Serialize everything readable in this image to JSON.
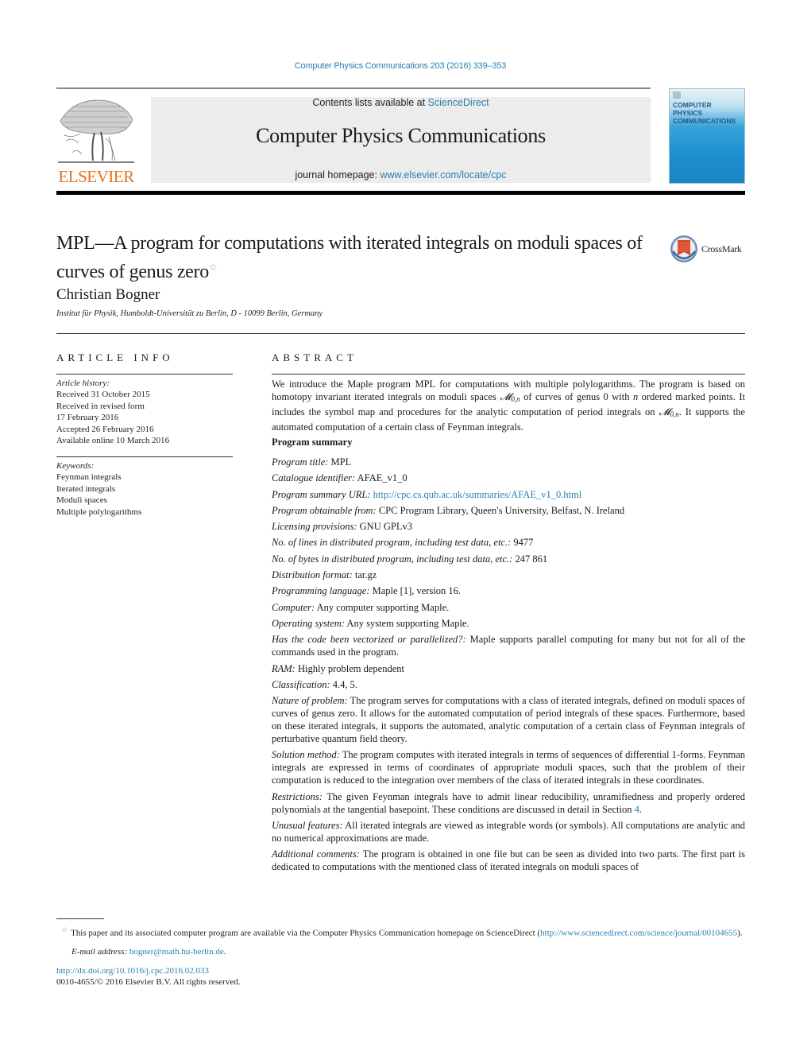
{
  "header": {
    "journal_reference": "Computer Physics Communications 203 (2016) 339–353",
    "contents_prefix": "Contents lists available at ",
    "contents_link": "ScienceDirect",
    "journal_title": "Computer Physics Communications",
    "homepage_prefix": "journal homepage: ",
    "homepage_link": "www.elsevier.com/locate/cpc",
    "publisher_logo_text": "ELSEVIER",
    "cover_title_line1": "COMPUTER PHYSICS",
    "cover_title_line2": "COMMUNICATIONS",
    "crossmark_label": "CrossMark"
  },
  "article": {
    "title": "MPL—A program for computations with iterated integrals on moduli spaces of curves of genus zero",
    "title_footnote_mark": "☆",
    "author": "Christian Bogner",
    "affiliation": "Institut für Physik, Humboldt-Universität zu Berlin, D - 10099 Berlin, Germany"
  },
  "article_info": {
    "label": "ARTICLE INFO",
    "history_heading": "Article history:",
    "history": [
      "Received 31 October 2015",
      "Received in revised form",
      "17 February 2016",
      "Accepted 26 February 2016",
      "Available online 10 March 2016"
    ],
    "keywords_heading": "Keywords:",
    "keywords": [
      "Feynman integrals",
      "Iterated integrals",
      "Moduli spaces",
      "Multiple polylogarithms"
    ]
  },
  "abstract": {
    "label": "ABSTRACT",
    "part1": "We introduce the Maple program MPL for computations with multiple polylogarithms. The program is based on homotopy invariant iterated integrals on moduli spaces ",
    "math_symbol": "𝓜",
    "math_subscript": "0,n",
    "part2": " of curves of genus 0 with ",
    "math_n": "n",
    "part3": " ordered marked points. It includes the symbol map and procedures for the analytic computation of period integrals on ",
    "part4": ". It supports the automated computation of a certain class of Feynman integrals."
  },
  "program_summary": {
    "heading": "Program summary",
    "items": [
      {
        "key": "Program title:",
        "value": " MPL"
      },
      {
        "key": "Catalogue identifier:",
        "value": " AFAE_v1_0"
      },
      {
        "key": "Program summary URL:",
        "value": " ",
        "link": "http://cpc.cs.qub.ac.uk/summaries/AFAE_v1_0.html"
      },
      {
        "key": "Program obtainable from:",
        "value": " CPC Program Library, Queen's University, Belfast, N. Ireland"
      },
      {
        "key": "Licensing provisions:",
        "value": " GNU GPLv3"
      },
      {
        "key": "No. of lines in distributed program, including test data, etc.:",
        "value": " 9477"
      },
      {
        "key": "No. of bytes in distributed program, including test data, etc.:",
        "value": " 247 861"
      },
      {
        "key": "Distribution format:",
        "value": " tar.gz"
      },
      {
        "key": "Programming language:",
        "value": " Maple [1], version 16."
      },
      {
        "key": "Computer:",
        "value": " Any computer supporting Maple."
      },
      {
        "key": "Operating system:",
        "value": " Any system supporting Maple."
      },
      {
        "key": "Has the code been vectorized or parallelized?:",
        "value": " Maple supports parallel computing for many but not for all of the commands used in the program."
      },
      {
        "key": "RAM:",
        "value": " Highly problem dependent"
      },
      {
        "key": "Classification:",
        "value": " 4.4, 5."
      },
      {
        "key": "Nature of problem:",
        "value": " The program serves for computations with a class of iterated integrals, defined on moduli spaces of curves of genus zero. It allows for the automated computation of period integrals of these spaces. Furthermore, based on these iterated integrals, it supports the automated, analytic computation of a certain class of Feynman integrals of perturbative quantum field theory."
      },
      {
        "key": "Solution method:",
        "value": " The program computes with iterated integrals in terms of sequences of differential 1-forms. Feynman integrals are expressed in terms of coordinates of appropriate moduli spaces, such that the problem of their computation is reduced to the integration over members of the class of iterated integrals in these coordinates."
      },
      {
        "key": "Restrictions:",
        "value": " The given Feynman integrals have to admit linear reducibility, unramifiedness and properly ordered polynomials at the tangential basepoint. These conditions are discussed in detail in Section ",
        "link": "4",
        "suffix": "."
      },
      {
        "key": "Unusual features:",
        "value": " All iterated integrals are viewed as integrable words (or symbols). All computations are analytic and no numerical approximations are made."
      },
      {
        "key": "Additional comments:",
        "value": " The program is obtained in one file but can be seen as divided into two parts. The first part is dedicated to computations with the mentioned class of iterated integrals on moduli spaces of"
      }
    ]
  },
  "footer": {
    "footnote_mark": "☆",
    "footnote_text": "This paper and its associated computer program are available via the Computer Physics Communication homepage on ScienceDirect  (",
    "footnote_link": "http://www.sciencedirect.com/science/journal/00104655",
    "footnote_suffix": ").",
    "email_label": "E-mail address:",
    "email": "bogner@math.hu-berlin.de",
    "email_suffix": ".",
    "doi": "http://dx.doi.org/10.1016/j.cpc.2016.02.033",
    "copyright": "0010-4655/© 2016 Elsevier B.V. All rights reserved."
  },
  "colors": {
    "link": "#2a7fb0",
    "elsevier_orange": "#e9711c",
    "header_box": "#ececec"
  }
}
